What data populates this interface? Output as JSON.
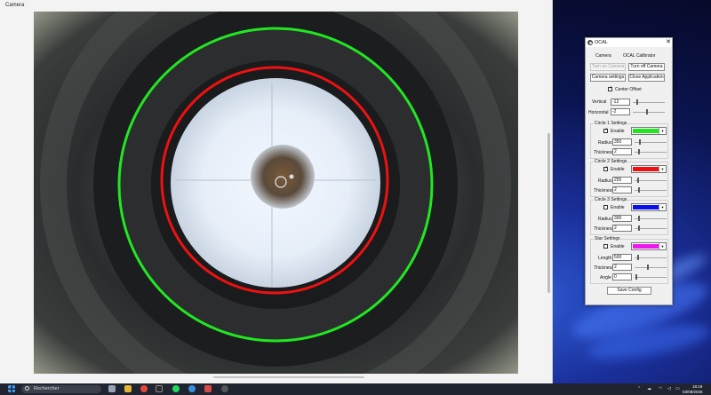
{
  "camera_window": {
    "title": "Camera"
  },
  "ocal": {
    "title": "OCAL",
    "tab_camera": "Camera",
    "tab_calibrator": "OCAL Calibrator",
    "btn_turn_on": "Turn on Camera",
    "btn_turn_off": "Turn off Camera",
    "btn_settings": "Camera settings",
    "btn_close_app": "Close Application",
    "center_offset_label": "Center Offset",
    "vertical_label": "Vertical",
    "vertical_value": "-12",
    "horizontal_label": "Horizontal",
    "horizontal_value": "-2",
    "circle1": {
      "title": "Circle 1 Settings",
      "enable": "Enable",
      "radius_label": "Radius",
      "radius": "350",
      "thickness_label": "Thickness",
      "thickness": "2",
      "color": "#22e622"
    },
    "circle2": {
      "title": "Circle 2 Settings",
      "enable": "Enable",
      "radius_label": "Radius",
      "radius": "255",
      "thickness_label": "Thickness",
      "thickness": "2",
      "color": "#ee1111"
    },
    "circle3": {
      "title": "Circle 3 Settings",
      "enable": "Enable",
      "radius_label": "Radius",
      "radius": "300",
      "thickness_label": "Thickness",
      "thickness": "2",
      "color": "#0a10e6"
    },
    "star": {
      "title": "Star Settings",
      "enable": "Enable",
      "length_label": "Length",
      "length": "500",
      "thickness_label": "Thickness",
      "thickness": "2",
      "angle_label": "Angle",
      "angle": "0",
      "color": "#ee18ee"
    },
    "save_btn": "Save Config"
  },
  "taskbar": {
    "search_placeholder": "Rechercher",
    "time": "18:19",
    "date": "03/09/2026"
  }
}
